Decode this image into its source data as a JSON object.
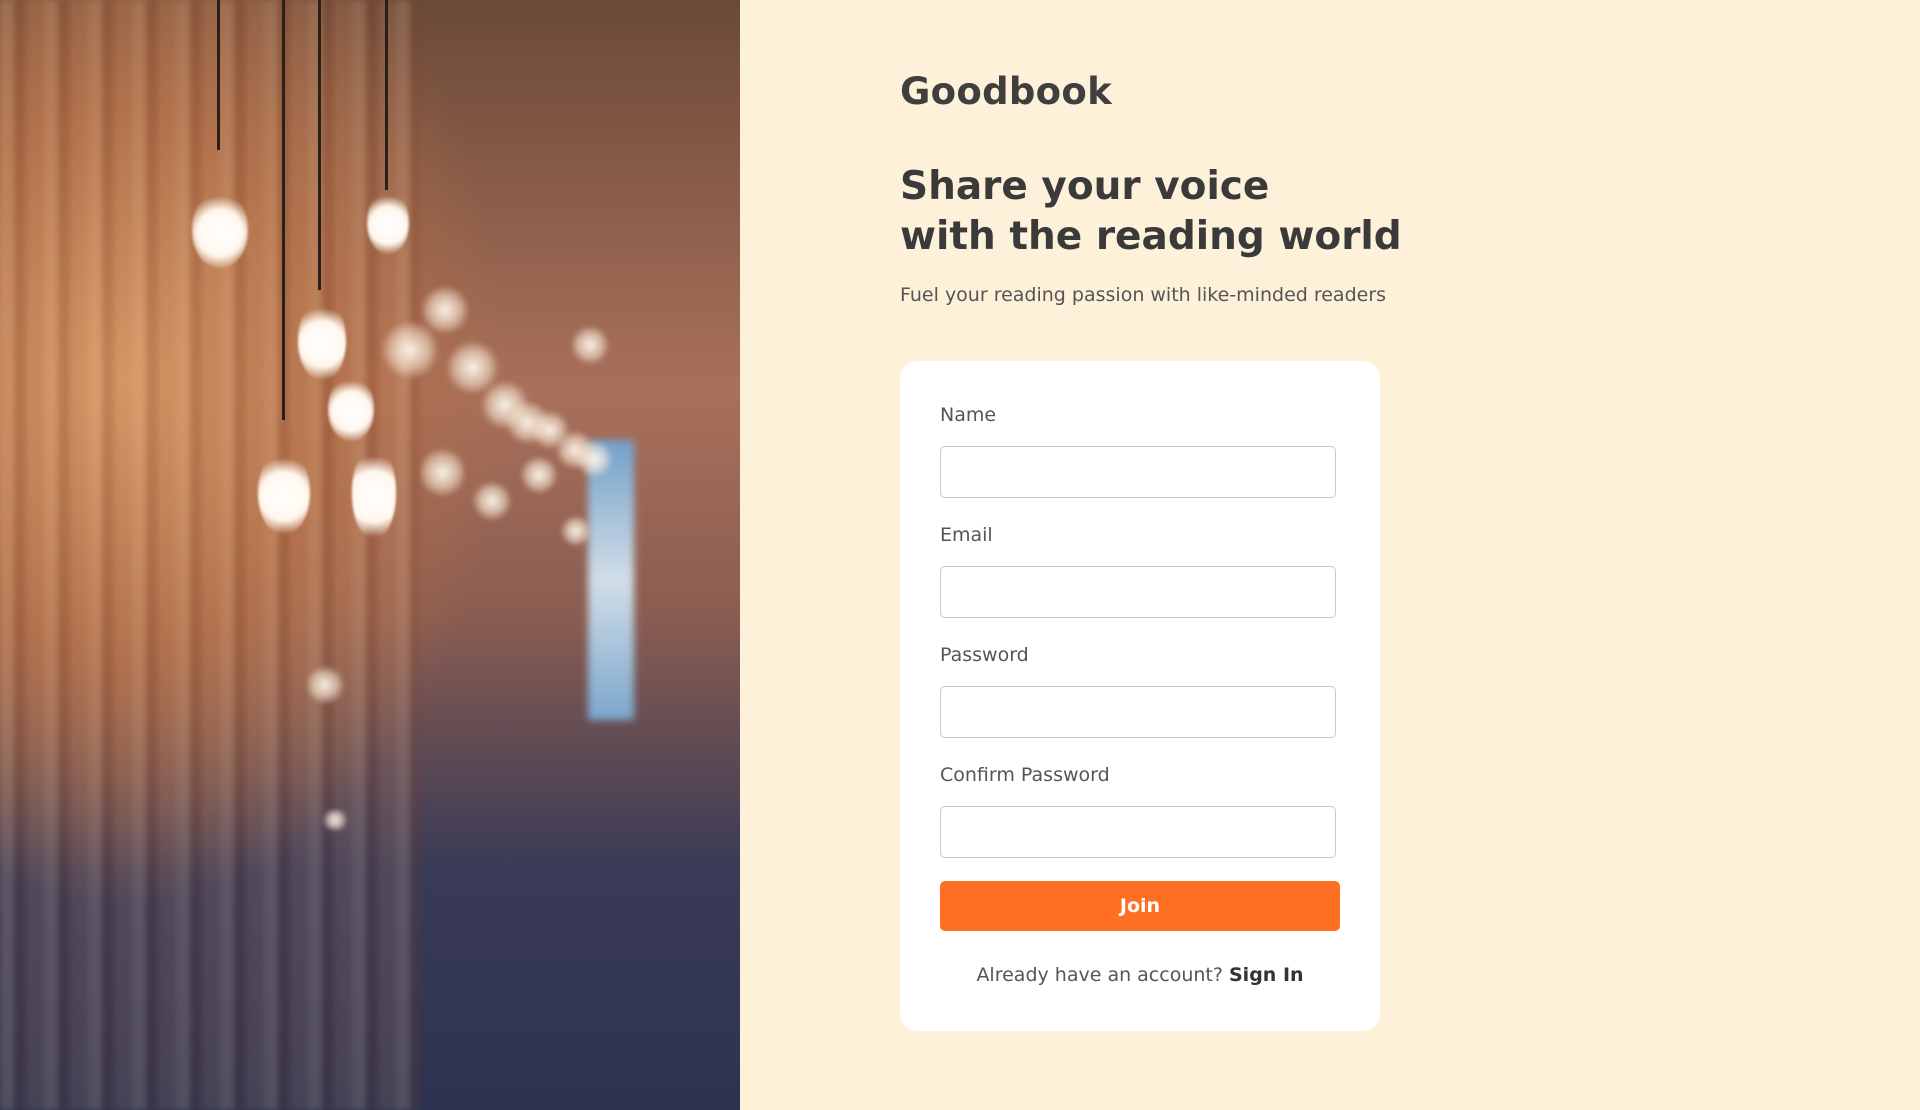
{
  "brand": "Goodbook",
  "headline": {
    "line1": "Share your voice",
    "line2": "with the reading world"
  },
  "subtitle": "Fuel your reading passion with like-minded readers",
  "form": {
    "name_label": "Name",
    "name_value": "",
    "email_label": "Email",
    "email_value": "",
    "password_label": "Password",
    "password_value": "",
    "confirm_label": "Confirm Password",
    "confirm_value": "",
    "submit_label": "Join"
  },
  "signin": {
    "prompt": "Already have an account?",
    "link_label": "Sign In"
  },
  "colors": {
    "page_background": "#fef1da",
    "card_background": "#ffffff",
    "accent": "#fe6f24",
    "text": "#3f3f3f"
  }
}
